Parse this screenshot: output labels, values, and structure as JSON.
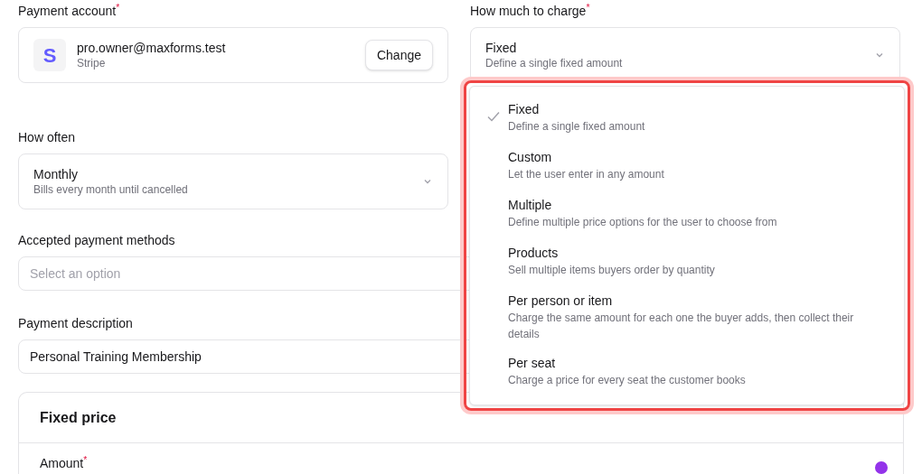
{
  "payment_account": {
    "label": "Payment account$^{*}$",
    "email": "pro.owner@maxforms.test",
    "provider": "Stripe",
    "logo_letter": "S",
    "button": "Change"
  },
  "charge": {
    "label": "How much to charge$^{*}$",
    "value": "Fixed",
    "description": "Define a single fixed amount",
    "expanded": true,
    "options": [
      {
        "title": "Fixed",
        "description": "Define a single fixed amount",
        "selected": true
      },
      {
        "title": "Custom",
        "description": "Let the user enter in any amount",
        "selected": false
      },
      {
        "title": "Multiple",
        "description": "Define multiple price options for the user to choose from",
        "selected": false
      },
      {
        "title": "Products",
        "description": "Sell multiple items buyers order by quantity",
        "selected": false
      },
      {
        "title": "Per person or item",
        "description": "Charge the same amount for each one the buyer adds, then collect their details",
        "selected": false
      },
      {
        "title": "Per seat",
        "description": "Charge a price for every seat the customer books",
        "selected": false
      }
    ]
  },
  "how_often": {
    "label": "How often",
    "value": "Monthly",
    "description": "Bills every month until cancelled"
  },
  "payment_methods": {
    "label": "Accepted payment methods",
    "placeholder": "Select an option"
  },
  "payment_description": {
    "label": "Payment description",
    "value": "Personal Training Membership"
  },
  "fixed_price": {
    "title": "Fixed price",
    "amount_label": "Amount$^{*}$"
  }
}
